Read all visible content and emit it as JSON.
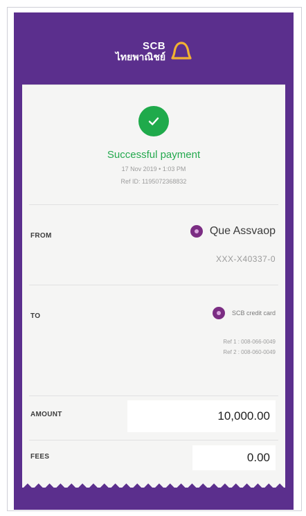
{
  "header": {
    "logo_top": "SCB",
    "logo_bottom": "ไทยพาณิชย์"
  },
  "status": {
    "title": "Successful payment",
    "datetime": "17 Nov 2019 • 1:03 PM",
    "ref_id": "Ref ID: 1195072368832"
  },
  "from": {
    "label": "FROM",
    "name": "Que Assvaop",
    "account": "XXX-X40337-0"
  },
  "to": {
    "label": "TO",
    "name": "SCB credit card",
    "ref1": "Ref 1 : 008-066-0049",
    "ref2": "Ref 2 : 008-060-0049"
  },
  "amount": {
    "label": "AMOUNT",
    "value": "10,000.00"
  },
  "fees": {
    "label": "FEES",
    "value": "0.00"
  },
  "colors": {
    "brand_purple": "#5b2f8d",
    "success_green": "#1faa4b",
    "logo_gold": "#f2b132"
  }
}
